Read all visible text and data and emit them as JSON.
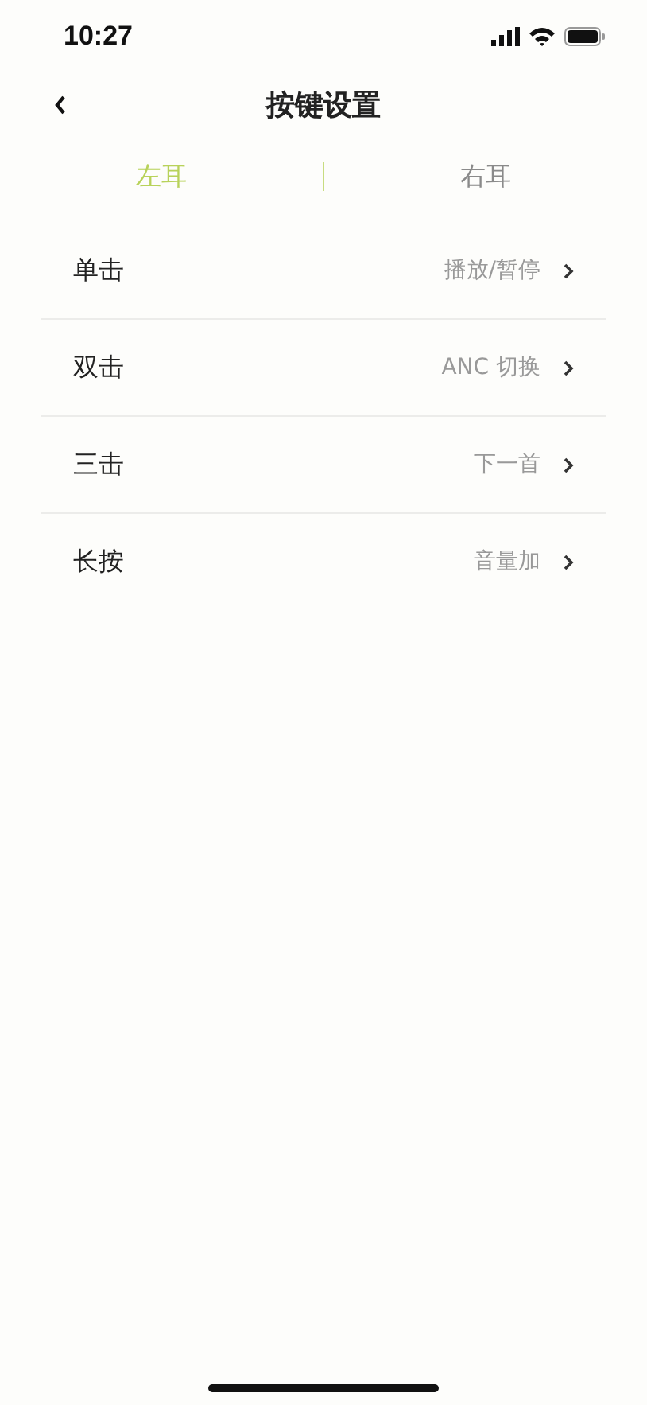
{
  "status_bar": {
    "time": "10:27"
  },
  "header": {
    "title": "按键设置"
  },
  "tabs": [
    {
      "label": "左耳",
      "selected": true
    },
    {
      "label": "右耳",
      "selected": false
    }
  ],
  "settings": [
    {
      "label": "单击",
      "value": "播放/暂停"
    },
    {
      "label": "双击",
      "value": "ANC 切换"
    },
    {
      "label": "三击",
      "value": "下一首"
    },
    {
      "label": "长按",
      "value": "音量加"
    }
  ]
}
